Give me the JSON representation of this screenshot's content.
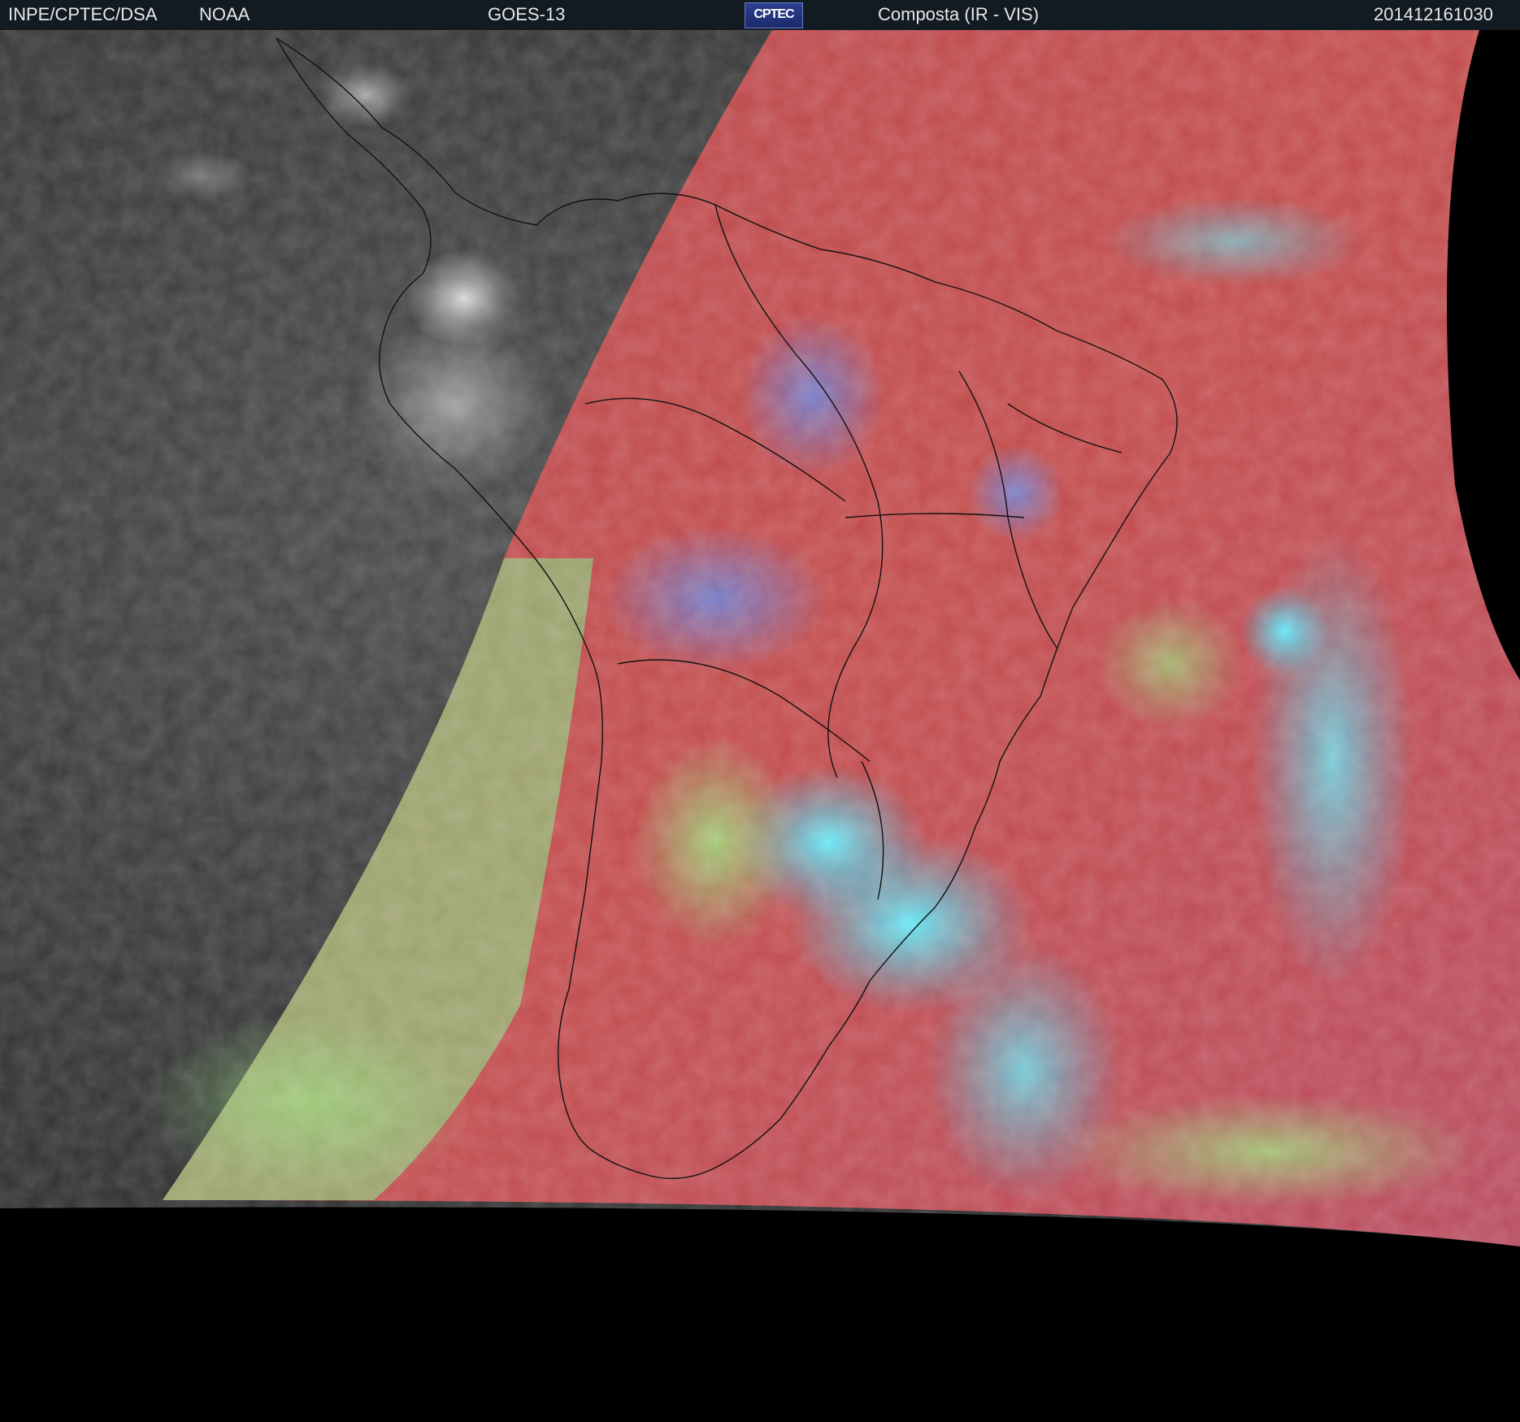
{
  "header": {
    "organization": "INPE/CPTEC/DSA",
    "agency": "NOAA",
    "satellite": "GOES-13",
    "logo_text": "CPTEC",
    "product": "Composta (IR - VIS)",
    "timestamp": "201412161030"
  },
  "colors": {
    "night_side": "#2f2f2f",
    "day_land": "#c44a4a",
    "cloud_cold": "#3fd8f0",
    "cloud_mid": "#8fd880",
    "space": "#000000"
  },
  "icons": [
    "cptec-logo-icon"
  ]
}
